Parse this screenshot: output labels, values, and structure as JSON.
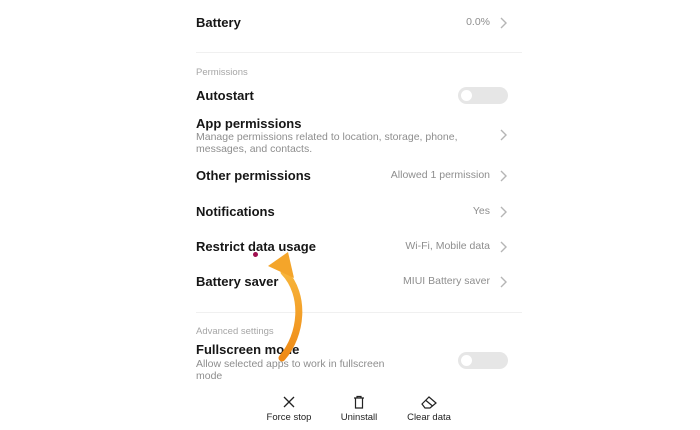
{
  "battery": {
    "label": "Battery",
    "value": "0.0%"
  },
  "permissions_section": "Permissions",
  "autostart": {
    "label": "Autostart",
    "enabled": false
  },
  "app_permissions": {
    "label": "App permissions",
    "description": "Manage permissions related to location, storage, phone, messages, and contacts."
  },
  "other_permissions": {
    "label": "Other permissions",
    "value": "Allowed 1 permission"
  },
  "notifications": {
    "label": "Notifications",
    "value": "Yes"
  },
  "restrict_data": {
    "label": "Restrict data usage",
    "value": "Wi-Fi, Mobile data"
  },
  "battery_saver": {
    "label": "Battery saver",
    "value": "MIUI Battery saver"
  },
  "advanced_section": "Advanced settings",
  "fullscreen": {
    "label": "Fullscreen mode",
    "description": "Allow selected apps to work in fullscreen mode",
    "enabled": false
  },
  "actions": {
    "force_stop": "Force stop",
    "uninstall": "Uninstall",
    "clear_data": "Clear data"
  },
  "icons": {
    "chevron": "chevron-right-icon",
    "force_stop": "close-icon",
    "uninstall": "trash-icon",
    "clear_data": "eraser-icon"
  },
  "colors": {
    "annotation_arrow": "#f39a1e",
    "annotation_dot": "#a01050"
  }
}
